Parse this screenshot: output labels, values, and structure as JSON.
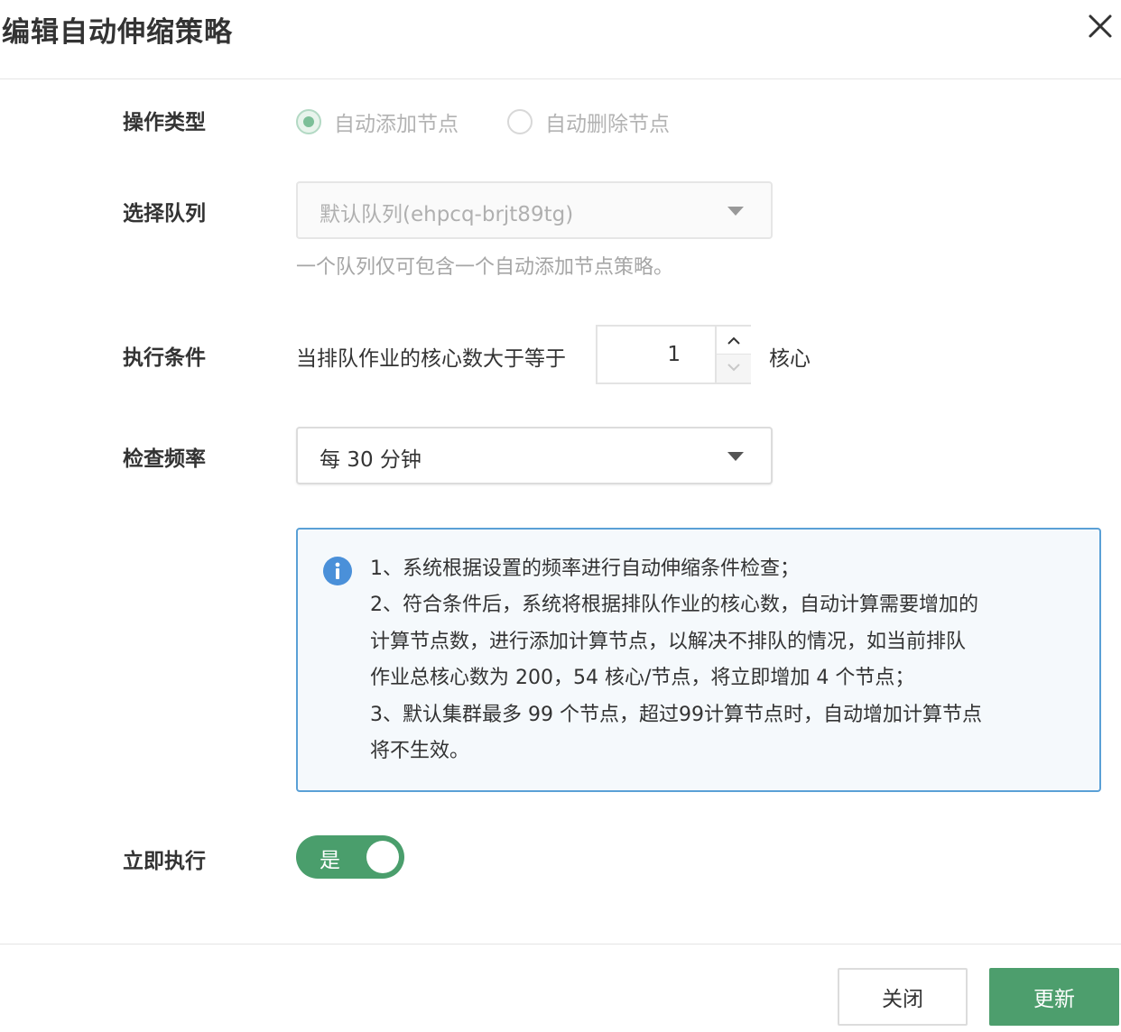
{
  "dialog": {
    "title": "编辑自动伸缩策略"
  },
  "form": {
    "operation_type": {
      "label": "操作类型",
      "options": [
        {
          "label": "自动添加节点",
          "checked": true
        },
        {
          "label": "自动删除节点",
          "checked": false
        }
      ]
    },
    "queue": {
      "label": "选择队列",
      "value": "默认队列(ehpcq-brjt89tg)",
      "hint": "一个队列仅可包含一个自动添加节点策略。"
    },
    "condition": {
      "label": "执行条件",
      "prefix": "当排队作业的核心数大于等于",
      "value": "1",
      "unit": "核心"
    },
    "frequency": {
      "label": "检查频率",
      "value": "每 30 分钟"
    },
    "info": {
      "lines": [
        "1、系统根据设置的频率进行自动伸缩条件检查；",
        "2、符合条件后，系统将根据排队作业的核心数，自动计算需要增加的",
        "计算节点数，进行添加计算节点，以解决不排队的情况，如当前排队",
        "作业总核心数为 200，54 核心/节点，将立即增加 4 个节点；",
        "3、默认集群最多 99 个节点，超过99计算节点时，自动增加计算节点",
        "将不生效。"
      ]
    },
    "execute_now": {
      "label": "立即执行",
      "toggle_text": "是",
      "on": true
    }
  },
  "footer": {
    "close_label": "关闭",
    "update_label": "更新"
  },
  "colors": {
    "primary_green": "#4d9e6d",
    "info_border": "#5aa0d6",
    "info_icon": "#4a90d9"
  },
  "icons": [
    "close-icon",
    "radio-checked",
    "radio-unchecked",
    "caret-down-icon",
    "chevron-up-icon",
    "chevron-down-icon",
    "info-icon"
  ]
}
